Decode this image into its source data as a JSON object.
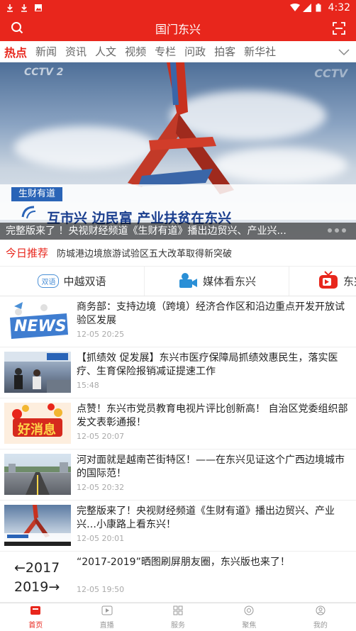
{
  "status_bar": {
    "time": "4:32"
  },
  "app_bar": {
    "title": "国门东兴"
  },
  "tabs": [
    {
      "label": "热点",
      "active": true
    },
    {
      "label": "新闻"
    },
    {
      "label": "资讯"
    },
    {
      "label": "人文"
    },
    {
      "label": "视频"
    },
    {
      "label": "专栏"
    },
    {
      "label": "问政"
    },
    {
      "label": "拍客"
    },
    {
      "label": "新华社"
    }
  ],
  "banner": {
    "logo_text": "CCTV 2",
    "tag": "生财有道",
    "headline": "互市兴 边民富 产业扶贫在东兴",
    "caption": "完整版来了 ！央视财经频道《生财有道》播出边贸兴、产业兴..."
  },
  "recommend": {
    "label": "今日推荐",
    "text": "防城港边境旅游试验区五大改革取得新突破"
  },
  "quick_links": [
    {
      "badge": "双语",
      "label": "中越双语"
    },
    {
      "label": "媒体看东兴"
    },
    {
      "label": "东兴"
    }
  ],
  "news": [
    {
      "title": "商务部：支持边境（跨境）经济合作区和沿边重点开发开放试验区发展",
      "time": "12-05 20:25",
      "thumb_text": "NEWS"
    },
    {
      "title": "【抓绩效 促发展】东兴市医疗保障局抓绩效惠民生，落实医疗、生育保险报销减证提速工作",
      "time": "15:48"
    },
    {
      "title": "点赞！东兴市党员教育电视片评比创新高！ 自治区党委组织部发文表彰通报！",
      "time": "12-05 20:07",
      "thumb_text": "好消息"
    },
    {
      "title": "河对面就是越南芒街特区！——在东兴见证这个广西边境城市的国际范！",
      "time": "12-05 20:32"
    },
    {
      "title": "完整版来了！央视财经频道《生财有道》播出边贸兴、产业兴…小康路上看东兴！",
      "time": "12-05 20:01"
    },
    {
      "title": "“2017-2019”晒图刷屏朋友圈，东兴版也来了！",
      "time": "12-05 19:50",
      "thumb_top": "←2017",
      "thumb_bottom": "2019→"
    }
  ],
  "bottom_nav": [
    {
      "label": "首页",
      "active": true
    },
    {
      "label": "直播"
    },
    {
      "label": "服务"
    },
    {
      "label": "聚焦"
    },
    {
      "label": "我的"
    }
  ],
  "colors": {
    "brand": "#e8261c",
    "accent_blue": "#2a64b7"
  }
}
